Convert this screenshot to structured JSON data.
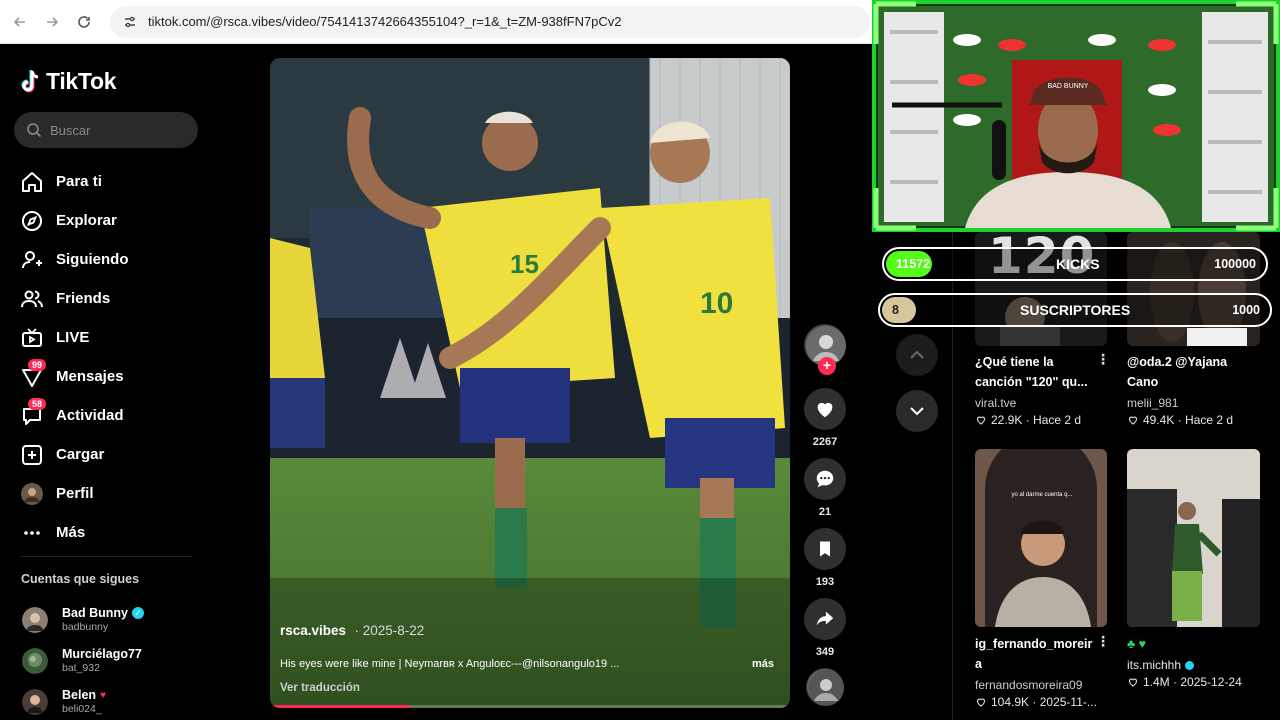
{
  "browser": {
    "url": "tiktok.com/@rsca.vibes/video/7541413742664355104?_r=1&_t=ZM-938fFN7pCv2"
  },
  "app": {
    "name": "TikTok"
  },
  "search": {
    "placeholder": "Buscar"
  },
  "menu": [
    {
      "label": "Para ti",
      "icon": "home-icon"
    },
    {
      "label": "Explorar",
      "icon": "compass-icon"
    },
    {
      "label": "Siguiendo",
      "icon": "user-plus-icon"
    },
    {
      "label": "Friends",
      "icon": "friends-icon"
    },
    {
      "label": "LIVE",
      "icon": "live-tv-icon"
    },
    {
      "label": "Mensajes",
      "icon": "messages-icon",
      "badge": "99"
    },
    {
      "label": "Actividad",
      "icon": "activity-icon",
      "badge": "58"
    },
    {
      "label": "Cargar",
      "icon": "upload-icon"
    },
    {
      "label": "Perfil",
      "icon": "profile-avatar"
    },
    {
      "label": "Más",
      "icon": "more-dots-icon"
    }
  ],
  "following": {
    "title": "Cuentas que sigues",
    "accounts": [
      {
        "name": "Bad Bunny",
        "user": "badbunny",
        "verified": true
      },
      {
        "name": "Murciélago77",
        "user": "bat_932"
      },
      {
        "name": "Belen",
        "user": "beli024_",
        "tag": "♥"
      }
    ]
  },
  "video": {
    "author": "rsca.vibes",
    "date": "· 2025-8-22",
    "caption": "His eyes were like mine | Neymarʙʀ x Anguloᴇᴄ---@nilsonangulo19 ...",
    "more": "más",
    "translate": "Ver traducción",
    "progress": 0.27,
    "jersey_left": "15",
    "jersey_right": "10"
  },
  "actions": {
    "likes": "2267",
    "comments": "21",
    "saves": "193",
    "shares": "349"
  },
  "feed": [
    {
      "title_line1": "¿Qué tiene la",
      "title_line2": "canción \"120\" qu...",
      "user": "viral.tve",
      "views": "22.9K",
      "date": "Hace 2 d"
    },
    {
      "title_line1": "@oda.2 @Yajana",
      "title_line2": "Cano",
      "user": "melii_981",
      "views": "49.4K",
      "date": "Hace 2 d"
    },
    {
      "title_line1": "ig_fernando_moreir",
      "title_line2": "a",
      "user": "fernandosmoreira09",
      "views": "104.9K",
      "date": "2025-11-..."
    },
    {
      "title_line1": "♣ ♥",
      "title_line2": "",
      "user": "its.michhh",
      "views": "1.4M",
      "date": "2025-12-24"
    }
  ],
  "thumb_overlay_text": "yo al darme cuenta q...",
  "overlay": {
    "big_number": "120",
    "kicks": {
      "current": "11572",
      "label": "KICKS",
      "goal": "100000",
      "fraction": 0.1157
    },
    "subs": {
      "current": "8",
      "label": "SUSCRIPTORES",
      "goal": "1000",
      "fraction": 0.008
    },
    "cap_text": "BAD BUNNY"
  },
  "colors": {
    "accent": "#fe2c55",
    "verified": "#20d5ec",
    "kicks_fill": "#53fc18",
    "subs_fill": "#d9c59a",
    "webcam_frame": "#1fd12e"
  }
}
